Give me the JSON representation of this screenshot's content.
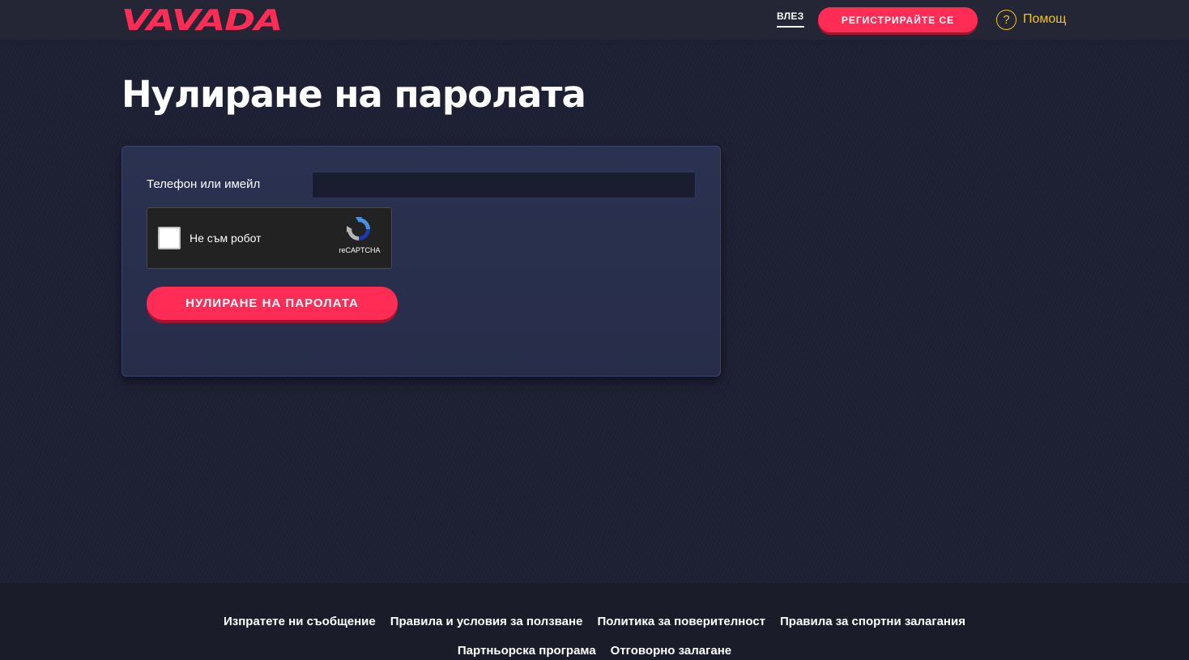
{
  "header": {
    "logo_text": "VAVADA",
    "login_label": "ВЛЕЗ",
    "register_label": "РЕГИСТРИРАЙТЕ СЕ",
    "help_label": "Помощ",
    "help_icon": "question-circle-icon"
  },
  "main": {
    "title": "Нулиране на паролата",
    "form": {
      "field_label": "Телефон или имейл",
      "field_value": "",
      "captcha_label": "Не съм робот",
      "captcha_brand": "reCAPTCHA",
      "submit_label": "НУЛИРАНЕ НА ПАРОЛАТА"
    }
  },
  "footer": {
    "row1": [
      "Изпратете ни съобщение",
      "Правила и условия за ползване",
      "Политика за поверителност",
      "Правила за спортни залагания"
    ],
    "row2": [
      "Партньорска програма",
      "Отговорно залагане"
    ]
  },
  "colors": {
    "accent": "#ff2d55",
    "help": "#f0c419",
    "background": "#1d1f33",
    "card": "#2a3251"
  }
}
